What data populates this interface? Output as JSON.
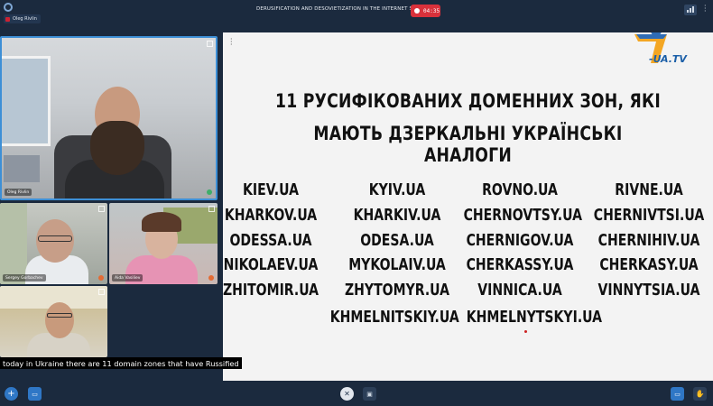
{
  "meeting": {
    "title": "DERUSIFICATION AND DESOVIETIZATION IN THE INTERNET SPACE",
    "recording_time": "04:35",
    "current_user": "Oleg Rivlin"
  },
  "participants": [
    {
      "name": "Oleg Rivlin"
    },
    {
      "name": "Sergey Gorbachev"
    },
    {
      "name": "Aida Vasiliev"
    },
    {
      "name": ""
    }
  ],
  "slide": {
    "logo_text": "-UA.TV",
    "title_line1": "11 РУСИФІКОВАНИХ ДОМЕННИХ ЗОН,  ЯКІ",
    "title_line2": "МАЮТЬ ДЗЕРКАЛЬНІ УКРАЇНСЬКІ АНАЛОГИ",
    "domains": [
      [
        "KIEV.UA",
        "KYIV.UA",
        "ROVNO.UA",
        "RIVNE.UA"
      ],
      [
        "KHARKOV.UA",
        "KHARKIV.UA",
        "CHERNOVTSY.UA",
        "CHERNIVTSI.UA"
      ],
      [
        "ODESSA.UA",
        "ODESA.UA",
        "CHERNIGOV.UA",
        "CHERNIHIV.UA"
      ],
      [
        "NIKOLAEV.UA",
        "MYKOLAIV.UA",
        "CHERKASSY.UA",
        "CHERKASY.UA"
      ],
      [
        "ZHITOMIR.UA",
        "ZHYTOMYR.UA",
        "VINNICA.UA",
        "VINNYTSIA.UA"
      ]
    ],
    "last_row": [
      "KHMELNITSKIY.UA",
      "KHMELNYTSKYI.UA"
    ]
  },
  "caption": "today in Ukraine there are 11 domain zones that have Russified",
  "colors": {
    "background": "#1b2a3e",
    "accent": "#2f77c6",
    "record": "#d9313b",
    "active_speaker": "#3d8fd6"
  }
}
